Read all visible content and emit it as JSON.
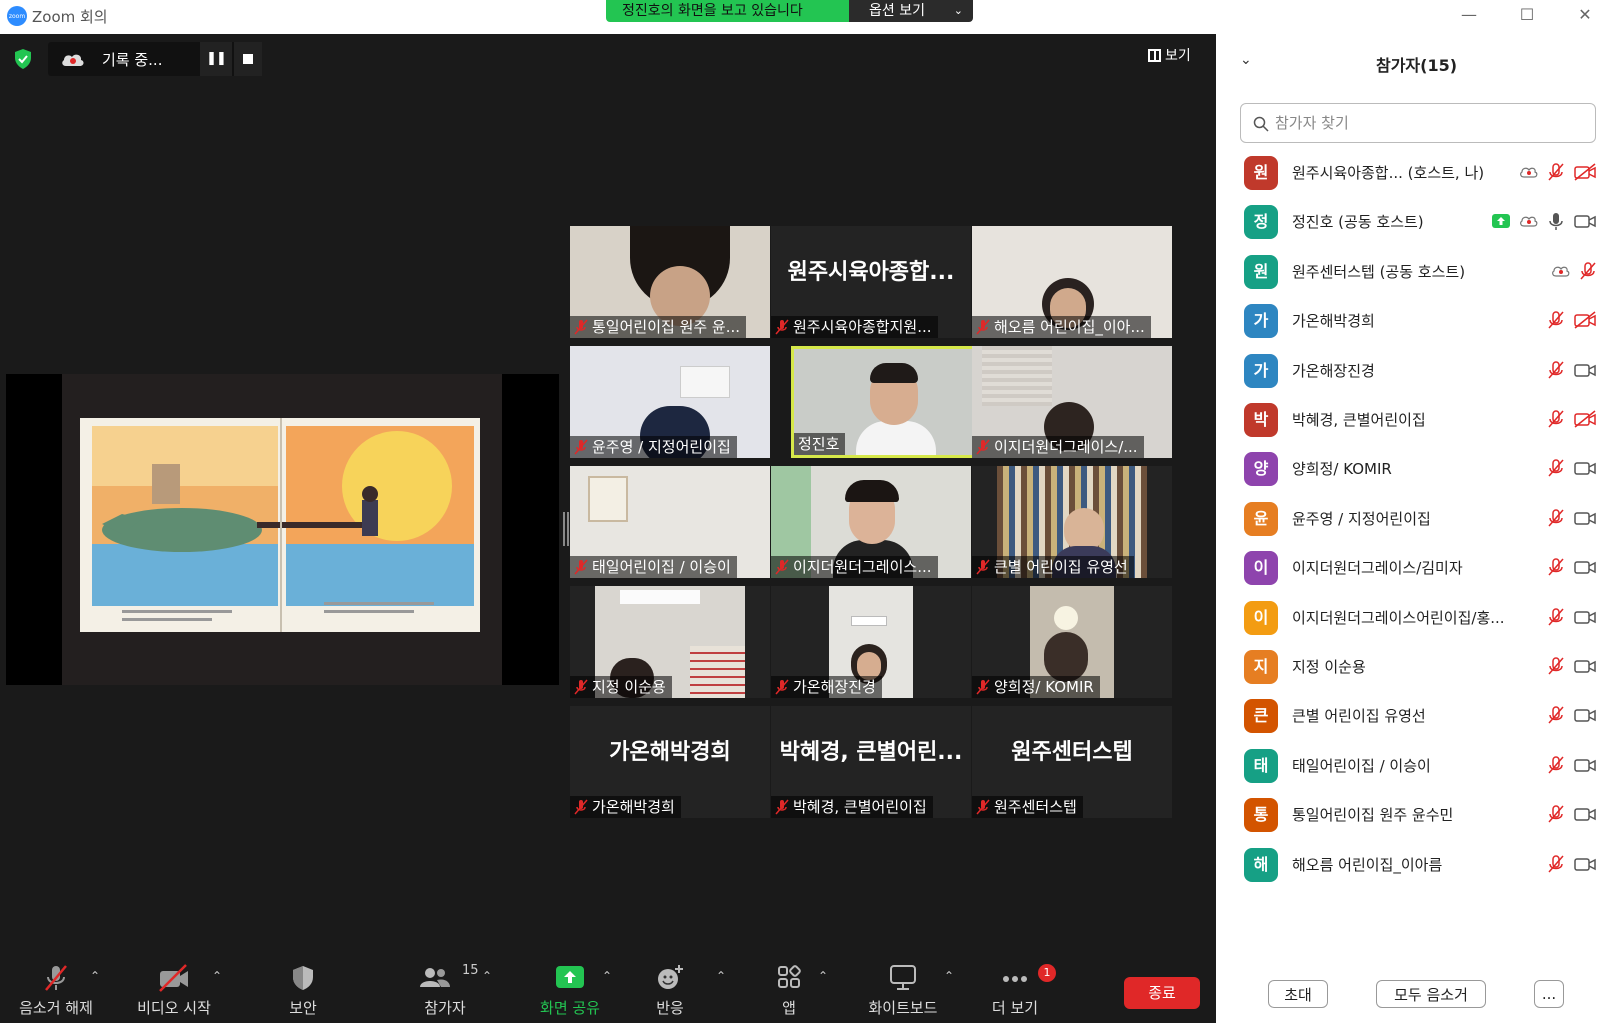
{
  "window": {
    "title": "Zoom 회의",
    "logo_text": "zoom"
  },
  "share_banner": {
    "message": "정진호의 화면을 보고 있습니다",
    "options_label": "옵션 보기"
  },
  "recording": {
    "label": "기록 중..."
  },
  "view_button": {
    "label": "보기"
  },
  "tiles": [
    {
      "name": "통일어린이집 원주 윤...",
      "big": ""
    },
    {
      "name": "원주시육아종합지원...",
      "big": "원주시육아종합..."
    },
    {
      "name": "해오름 어린이집_이아...",
      "big": ""
    },
    {
      "name": "윤주영 / 지정어린이집",
      "big": ""
    },
    {
      "name": "정진호",
      "big": ""
    },
    {
      "name": "이지더원더그레이스/...",
      "big": ""
    },
    {
      "name": "태일어린이집 / 이승이",
      "big": ""
    },
    {
      "name": "이지더원더그레이스...",
      "big": ""
    },
    {
      "name": "큰별 어린이집 유영선",
      "big": ""
    },
    {
      "name": "지정 이순용",
      "big": ""
    },
    {
      "name": "가온해장진경",
      "big": ""
    },
    {
      "name": "양희정/ KOMIR",
      "big": ""
    },
    {
      "name": "가온해박경희",
      "big": "가온해박경희"
    },
    {
      "name": "박혜경, 큰별어린이집",
      "big": "박혜경, 큰별어린..."
    },
    {
      "name": "원주센터스텝",
      "big": "원주센터스텝"
    }
  ],
  "toolbar": {
    "unmute": "음소거 해제",
    "start_video": "비디오 시작",
    "security": "보안",
    "participants": "참가자",
    "participants_count": "15",
    "share_screen": "화면 공유",
    "reactions": "반응",
    "apps": "앱",
    "whiteboard": "화이트보드",
    "more": "더 보기",
    "more_badge": "1",
    "end": "종료"
  },
  "panel": {
    "title": "참가자(15)",
    "search_placeholder": "참가자 찾기",
    "participants": [
      {
        "initial": "원",
        "name": "원주시육아종합...   (호스트, 나)",
        "color": "#c0392b"
      },
      {
        "initial": "정",
        "name": "정진호 (공동 호스트)",
        "color": "#16a085"
      },
      {
        "initial": "원",
        "name": "원주센터스텝 (공동 호스트)",
        "color": "#16a085"
      },
      {
        "initial": "가",
        "name": "가온해박경희",
        "color": "#2e86c1"
      },
      {
        "initial": "가",
        "name": "가온해장진경",
        "color": "#2e86c1"
      },
      {
        "initial": "박",
        "name": "박혜경, 큰별어린이집",
        "color": "#c0392b"
      },
      {
        "initial": "양",
        "name": "양희정/ KOMIR",
        "color": "#8e44ad"
      },
      {
        "initial": "윤",
        "name": "윤주영 / 지정어린이집",
        "color": "#e67e22"
      },
      {
        "initial": "이",
        "name": "이지더원더그레이스/김미자",
        "color": "#8e44ad"
      },
      {
        "initial": "이",
        "name": "이지더원더그레이스어린이집/홍...",
        "color": "#f39c12"
      },
      {
        "initial": "지",
        "name": "지정 이순용",
        "color": "#e67e22"
      },
      {
        "initial": "큰",
        "name": "큰별 어린이집 유영선",
        "color": "#d35400"
      },
      {
        "initial": "태",
        "name": "태일어린이집 / 이승이",
        "color": "#16a085"
      },
      {
        "initial": "통",
        "name": "통일어린이집 원주 윤수민",
        "color": "#d35400"
      },
      {
        "initial": "해",
        "name": "해오름 어린이집_이아름",
        "color": "#16a085"
      }
    ],
    "invite": "초대",
    "mute_all": "모두 음소거",
    "more": "..."
  },
  "colors": {
    "accent_green": "#23c552",
    "end_red": "#e02828",
    "muted_red": "#e02828",
    "active_speaker": "#d6e84a"
  }
}
